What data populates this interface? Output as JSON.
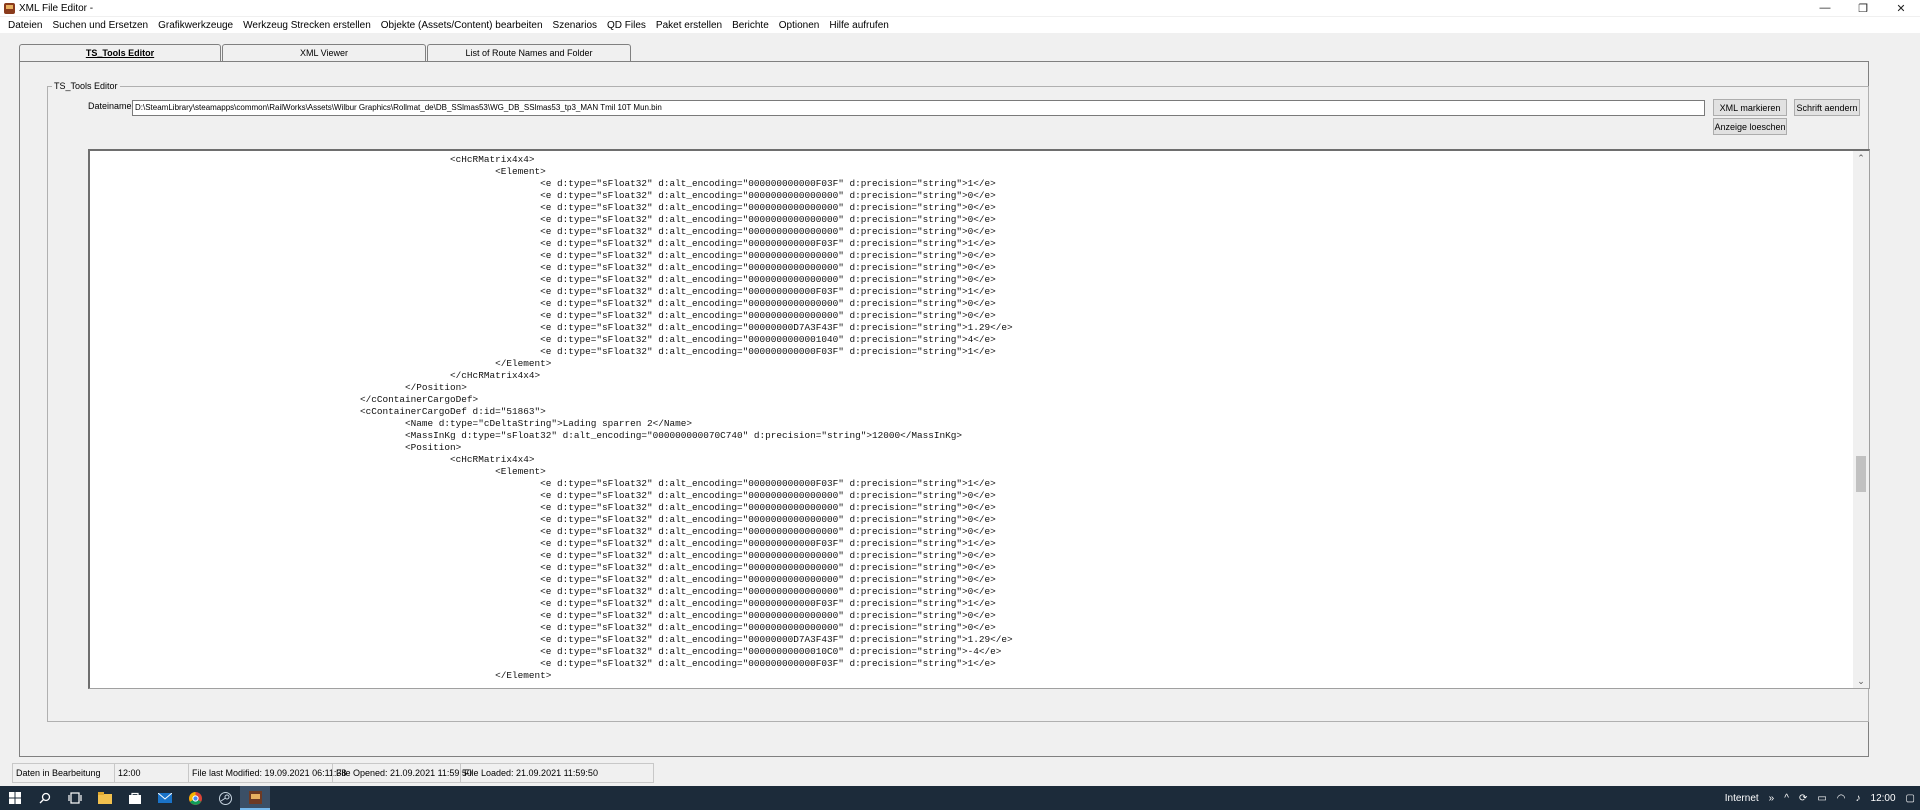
{
  "window": {
    "title": "XML File Editor -",
    "controls": [
      "—",
      "❐",
      "✕"
    ]
  },
  "menu": [
    "Dateien",
    "Suchen und Ersetzen",
    "Grafikwerkzeuge",
    "Werkzeug Strecken erstellen",
    "Objekte (Assets/Content) bearbeiten",
    "Szenarios",
    "QD Files",
    "Paket erstellen",
    "Berichte",
    "Optionen",
    "Hilfe aufrufen"
  ],
  "tabs": [
    "TS_Tools Editor",
    "XML Viewer",
    "List of Route Names and Folder"
  ],
  "group": {
    "legend": "TS_Tools Editor",
    "file_label": "Dateiname:",
    "file_value": "D:\\SteamLibrary\\steamapps\\common\\RailWorks\\Assets\\Wilbur Graphics\\Rollmat_de\\DB_SSlmas53\\WG_DB_SSlmas53_tp3_MAN Tmil 10T Mun.bin",
    "btn_mark": "XML markieren",
    "btn_font": "Schrift aendern",
    "btn_clear": "Anzeige loeschen"
  },
  "code_lines": [
    "                                                                <cHcRMatrix4x4>",
    "                                                                        <Element>",
    "                                                                                <e d:type=\"sFloat32\" d:alt_encoding=\"000000000000F03F\" d:precision=\"string\">1</e>",
    "                                                                                <e d:type=\"sFloat32\" d:alt_encoding=\"0000000000000000\" d:precision=\"string\">0</e>",
    "                                                                                <e d:type=\"sFloat32\" d:alt_encoding=\"0000000000000000\" d:precision=\"string\">0</e>",
    "                                                                                <e d:type=\"sFloat32\" d:alt_encoding=\"0000000000000000\" d:precision=\"string\">0</e>",
    "                                                                                <e d:type=\"sFloat32\" d:alt_encoding=\"0000000000000000\" d:precision=\"string\">0</e>",
    "                                                                                <e d:type=\"sFloat32\" d:alt_encoding=\"000000000000F03F\" d:precision=\"string\">1</e>",
    "                                                                                <e d:type=\"sFloat32\" d:alt_encoding=\"0000000000000000\" d:precision=\"string\">0</e>",
    "                                                                                <e d:type=\"sFloat32\" d:alt_encoding=\"0000000000000000\" d:precision=\"string\">0</e>",
    "                                                                                <e d:type=\"sFloat32\" d:alt_encoding=\"0000000000000000\" d:precision=\"string\">0</e>",
    "                                                                                <e d:type=\"sFloat32\" d:alt_encoding=\"000000000000F03F\" d:precision=\"string\">1</e>",
    "                                                                                <e d:type=\"sFloat32\" d:alt_encoding=\"0000000000000000\" d:precision=\"string\">0</e>",
    "                                                                                <e d:type=\"sFloat32\" d:alt_encoding=\"0000000000000000\" d:precision=\"string\">0</e>",
    "                                                                                <e d:type=\"sFloat32\" d:alt_encoding=\"00000000D7A3F43F\" d:precision=\"string\">1.29</e>",
    "                                                                                <e d:type=\"sFloat32\" d:alt_encoding=\"0000000000001040\" d:precision=\"string\">4</e>",
    "                                                                                <e d:type=\"sFloat32\" d:alt_encoding=\"000000000000F03F\" d:precision=\"string\">1</e>",
    "                                                                        </Element>",
    "                                                                </cHcRMatrix4x4>",
    "                                                        </Position>",
    "                                                </cContainerCargoDef>",
    "                                                <cContainerCargoDef d:id=\"51863\">",
    "                                                        <Name d:type=\"cDeltaString\">Lading sparren 2</Name>",
    "                                                        <MassInKg d:type=\"sFloat32\" d:alt_encoding=\"000000000070C740\" d:precision=\"string\">12000</MassInKg>",
    "                                                        <Position>",
    "                                                                <cHcRMatrix4x4>",
    "                                                                        <Element>",
    "                                                                                <e d:type=\"sFloat32\" d:alt_encoding=\"000000000000F03F\" d:precision=\"string\">1</e>",
    "                                                                                <e d:type=\"sFloat32\" d:alt_encoding=\"0000000000000000\" d:precision=\"string\">0</e>",
    "                                                                                <e d:type=\"sFloat32\" d:alt_encoding=\"0000000000000000\" d:precision=\"string\">0</e>",
    "                                                                                <e d:type=\"sFloat32\" d:alt_encoding=\"0000000000000000\" d:precision=\"string\">0</e>",
    "                                                                                <e d:type=\"sFloat32\" d:alt_encoding=\"0000000000000000\" d:precision=\"string\">0</e>",
    "                                                                                <e d:type=\"sFloat32\" d:alt_encoding=\"000000000000F03F\" d:precision=\"string\">1</e>",
    "                                                                                <e d:type=\"sFloat32\" d:alt_encoding=\"0000000000000000\" d:precision=\"string\">0</e>",
    "                                                                                <e d:type=\"sFloat32\" d:alt_encoding=\"0000000000000000\" d:precision=\"string\">0</e>",
    "                                                                                <e d:type=\"sFloat32\" d:alt_encoding=\"0000000000000000\" d:precision=\"string\">0</e>",
    "                                                                                <e d:type=\"sFloat32\" d:alt_encoding=\"0000000000000000\" d:precision=\"string\">0</e>",
    "                                                                                <e d:type=\"sFloat32\" d:alt_encoding=\"000000000000F03F\" d:precision=\"string\">1</e>",
    "                                                                                <e d:type=\"sFloat32\" d:alt_encoding=\"0000000000000000\" d:precision=\"string\">0</e>",
    "                                                                                <e d:type=\"sFloat32\" d:alt_encoding=\"0000000000000000\" d:precision=\"string\">0</e>",
    "                                                                                <e d:type=\"sFloat32\" d:alt_encoding=\"00000000D7A3F43F\" d:precision=\"string\">1.29</e>",
    "                                                                                <e d:type=\"sFloat32\" d:alt_encoding=\"00000000000010C0\" d:precision=\"string\">-4</e>",
    "                                                                                <e d:type=\"sFloat32\" d:alt_encoding=\"000000000000F03F\" d:precision=\"string\">1</e>",
    "                                                                        </Element>"
  ],
  "status": [
    "Daten in Bearbeitung",
    "12:00",
    "File last Modified: 19.09.2021 06:11:38",
    "File Opened: 21.09.2021 11:59:50",
    "File Loaded: 21.09.2021 11:59:50"
  ],
  "taskbar": {
    "icons": [
      "windows-start-icon",
      "search-icon",
      "task-view-icon",
      "file-explorer-icon",
      "store-icon",
      "mail-icon",
      "chrome-icon",
      "steam-icon",
      "xml-editor-icon"
    ],
    "network_label": "Internet",
    "chevron": "»",
    "clock": "12:00"
  }
}
